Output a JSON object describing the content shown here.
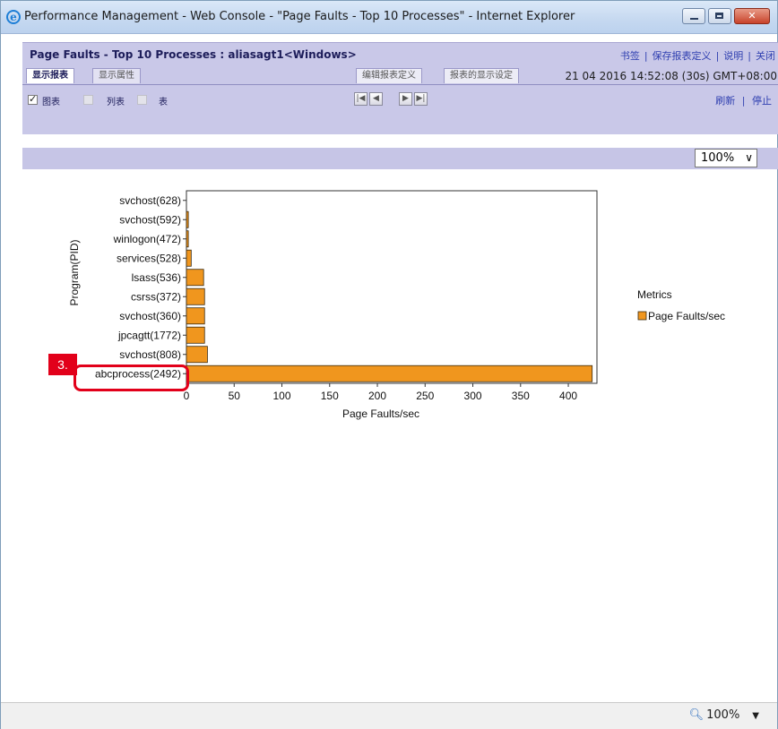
{
  "window": {
    "title": "Performance Management - Web Console - \"Page Faults - Top 10 Processes\" - Internet Explorer",
    "ie_icon": "e"
  },
  "header": {
    "report_title": "Page Faults - Top 10 Processes : aliasagt1<Windows>",
    "links": [
      "书签",
      "保存报表定义",
      "说明",
      "关闭"
    ],
    "tabs": [
      "显示报表",
      "显示属性"
    ],
    "right_tabs": [
      "编辑报表定义",
      "报表的显示设定"
    ],
    "timestamp": "21 04 2016 14:52:08  (30s)  GMT+08:00"
  },
  "toolbar": {
    "checkboxes": [
      {
        "label": "图表",
        "checked": true
      },
      {
        "label": "列表",
        "checked": false
      },
      {
        "label": "表",
        "checked": false
      }
    ],
    "nav": [
      "first-page",
      "prev-page",
      "next-page",
      "last-page"
    ],
    "refresh": "刷新",
    "stop": "停止"
  },
  "band": {
    "zoom": "100%"
  },
  "callout": "3.",
  "status": {
    "zoom": "100%"
  },
  "chart_data": {
    "type": "bar",
    "orientation": "horizontal",
    "categories": [
      "svchost(628)",
      "svchost(592)",
      "winlogon(472)",
      "services(528)",
      "lsass(536)",
      "csrss(372)",
      "svchost(360)",
      "jpcagtt(1772)",
      "svchost(808)",
      "abcprocess(2492)"
    ],
    "series": [
      {
        "name": "Page Faults/sec",
        "values": [
          0,
          2,
          2,
          5,
          18,
          19,
          19,
          19,
          22,
          425
        ]
      }
    ],
    "xlabel": "Page Faults/sec",
    "ylabel": "Program(PID)",
    "xticks": [
      0,
      50,
      100,
      150,
      200,
      250,
      300,
      350,
      400
    ],
    "xlim": [
      0,
      430
    ],
    "legend_title": "Metrics",
    "legend_position": "right",
    "bar_color": "#f0961e",
    "grid": false
  }
}
